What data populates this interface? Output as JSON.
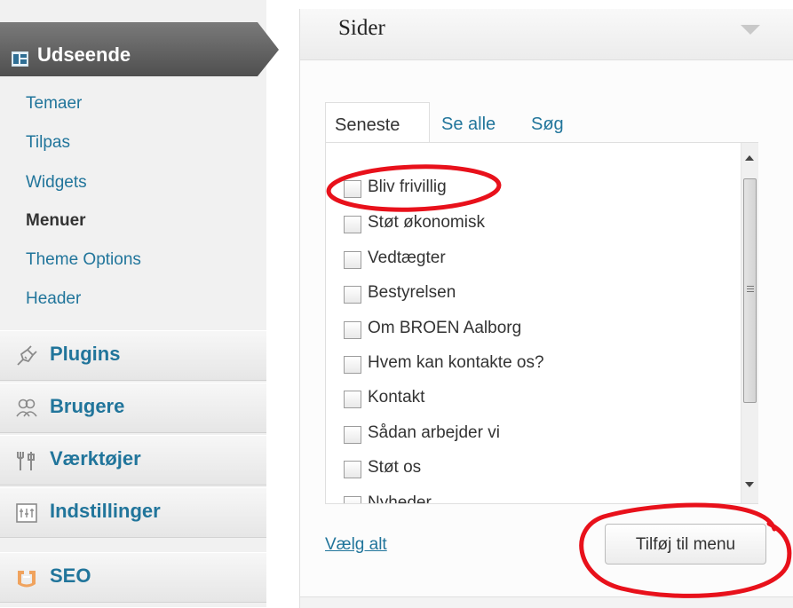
{
  "sidebar": {
    "current_menu": {
      "label": "Udseende",
      "icon": "appearance-icon"
    },
    "submenu": [
      {
        "label": "Temaer",
        "current": false
      },
      {
        "label": "Tilpas",
        "current": false
      },
      {
        "label": "Widgets",
        "current": false
      },
      {
        "label": "Menuer",
        "current": true
      },
      {
        "label": "Theme Options",
        "current": false
      },
      {
        "label": "Header",
        "current": false
      }
    ],
    "menu_groups": [
      {
        "label": "Plugins",
        "icon": "plugin-icon"
      },
      {
        "label": "Brugere",
        "icon": "users-icon"
      },
      {
        "label": "Værktøjer",
        "icon": "tools-icon"
      },
      {
        "label": "Indstillinger",
        "icon": "settings-icon"
      },
      {
        "label": "SEO",
        "icon": "seo-icon"
      }
    ]
  },
  "panel": {
    "title": "Sider",
    "tabs": [
      {
        "label": "Seneste",
        "active": true
      },
      {
        "label": "Se alle",
        "active": false
      },
      {
        "label": "Søg",
        "active": false
      }
    ],
    "pages": [
      {
        "label": "Bliv frivillig",
        "checked": false
      },
      {
        "label": "Støt økonomisk",
        "checked": false
      },
      {
        "label": "Vedtægter",
        "checked": false
      },
      {
        "label": "Bestyrelsen",
        "checked": false
      },
      {
        "label": "Om BROEN Aalborg",
        "checked": false
      },
      {
        "label": "Hvem kan kontakte os?",
        "checked": false
      },
      {
        "label": "Kontakt",
        "checked": false
      },
      {
        "label": "Sådan arbejder vi",
        "checked": false
      },
      {
        "label": "Støt os",
        "checked": false
      },
      {
        "label": "Nyheder",
        "checked": false
      }
    ],
    "select_all_label": "Vælg alt",
    "add_button_label": "Tilføj til menu"
  },
  "colors": {
    "link": "#21759b",
    "sidebar_active": "#5e5e5e",
    "annotation": "#e8111b"
  }
}
